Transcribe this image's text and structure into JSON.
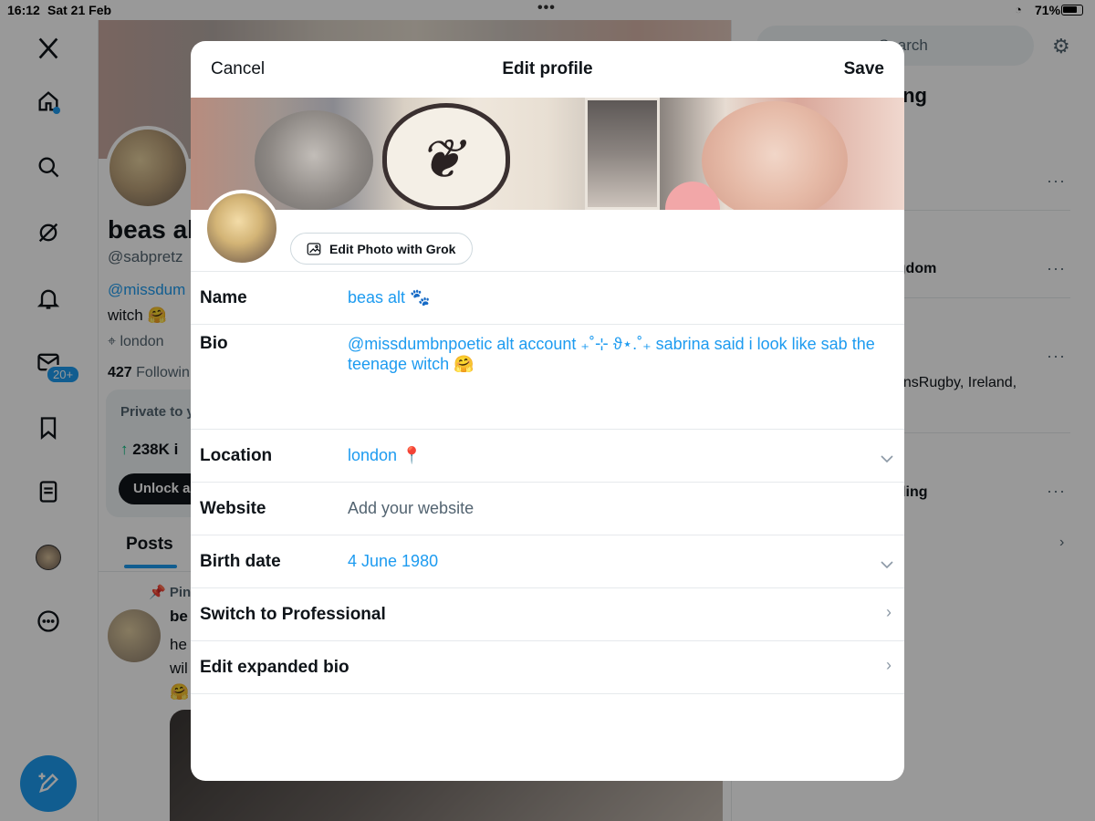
{
  "status_bar": {
    "time": "16:12",
    "date": "Sat 21 Feb",
    "battery": "71%"
  },
  "background_profile": {
    "name": "beas alt",
    "handle": "@sabpretz",
    "bio_link": "@missdum",
    "bio_text": "witch 🤗",
    "location": "london",
    "following_count": "427",
    "following_label": "Followin",
    "card_title": "Private to y",
    "card_stat": "238K i",
    "card_button": "Unlock a",
    "tab_posts": "Posts",
    "pinned_label": "Pin",
    "post_author": "be",
    "post_text": [
      "he",
      "wil",
      "🤗"
    ],
    "messages_badge": "20+"
  },
  "right_column": {
    "search_placeholder": "Search",
    "trending_heading": "ing",
    "rows": [
      {
        "text": "ngdom"
      },
      {
        "text": "tionsRugby, Ireland,"
      },
      {
        "text": "nding"
      }
    ]
  },
  "modal": {
    "cancel_label": "Cancel",
    "title": "Edit profile",
    "save_label": "Save",
    "grok_button_label": "Edit Photo with Grok",
    "fields": {
      "name_label": "Name",
      "name_value": "beas alt 🐾",
      "bio_label": "Bio",
      "bio_value": "@missdumbnpoetic alt account ₊˚⊹ ϑ⋆.˚₊ sabrina said i look like sab the teenage witch 🤗",
      "location_label": "Location",
      "location_value": "london 📍",
      "website_label": "Website",
      "website_placeholder": "Add your website",
      "birthdate_label": "Birth date",
      "birthdate_value": "4 June 1980",
      "professional_label": "Switch to Professional",
      "expanded_bio_label": "Edit expanded bio"
    }
  },
  "colors": {
    "accent": "#1d9bf0",
    "text_primary": "#0f1419",
    "text_secondary": "#536471",
    "divider": "#e6e9ec"
  }
}
